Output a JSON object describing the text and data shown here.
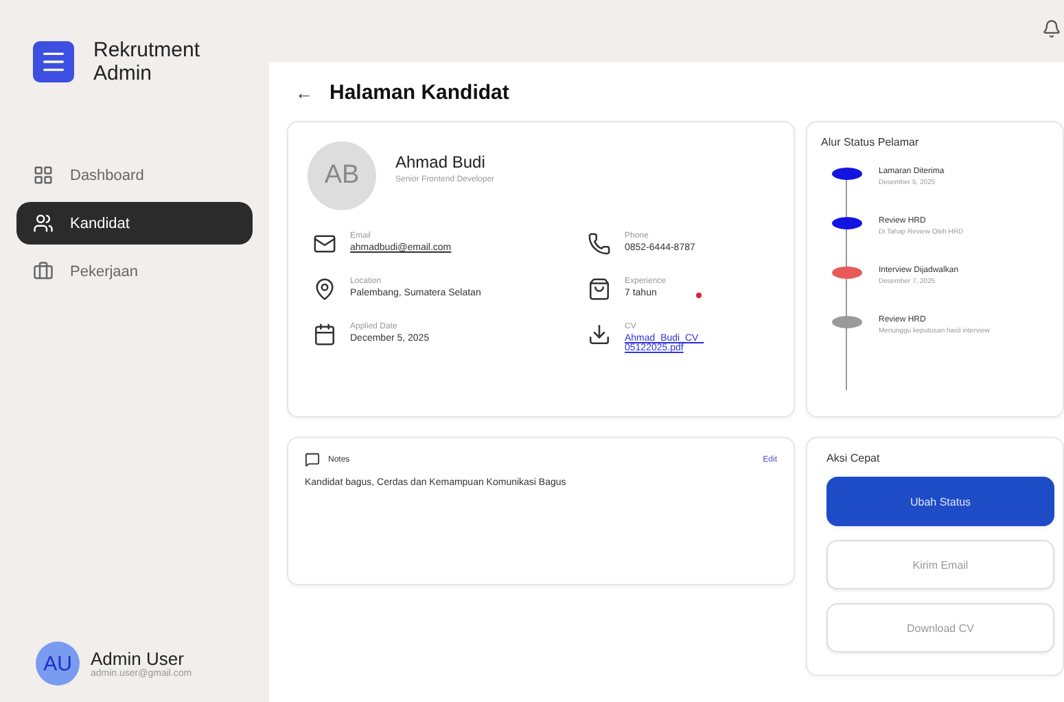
{
  "sidebar": {
    "brand": "Rekrutment Admin",
    "items": [
      {
        "label": "Dashboard",
        "selected": false
      },
      {
        "label": "Kandidat",
        "selected": true
      },
      {
        "label": "Pekerjaan",
        "selected": false
      }
    ],
    "user": {
      "initials": "AU",
      "name": "Admin User",
      "email": "admin.user@gmail.com"
    }
  },
  "page": {
    "back": "←",
    "title": "Halaman Kandidat"
  },
  "profile": {
    "initials": "AB",
    "name": "Ahmad Budi",
    "role": "Senior Frontend Developer",
    "fields": [
      {
        "label": "Email",
        "value": "ahmadbudi@email.com",
        "kind": "link"
      },
      {
        "label": "Phone",
        "value": "0852-6444-8787",
        "kind": "text"
      },
      {
        "label": "Location",
        "value": "Palembang, Sumatera Selatan",
        "kind": "text"
      },
      {
        "label": "Experience",
        "value": "7 tahun",
        "kind": "text",
        "flag": true
      },
      {
        "label": "Applied Date",
        "value": "December 5, 2025",
        "kind": "text"
      },
      {
        "label": "CV",
        "value": "Ahmad_Budi_CV_ 05122025.pdf",
        "kind": "file"
      }
    ]
  },
  "status_flow": {
    "title": "Alur Status Pelamar",
    "steps": [
      {
        "title": "Lamaran Diterima",
        "detail": "Desember 5, 2025",
        "color": "#1414e0"
      },
      {
        "title": "Review HRD",
        "detail": "Di Tahap Review Oleh HRD",
        "color": "#1414e0"
      },
      {
        "title": "Interview Dijadwalkan",
        "detail": "Desember 7, 2025",
        "color": "#e85a5a"
      },
      {
        "title": "Review HRD",
        "detail": "Menunggu keputusan hasil interview",
        "color": "#9a9a9a"
      }
    ]
  },
  "notes": {
    "title": "Notes",
    "action": "Edit",
    "text": "Kandidat bagus, Cerdas dan Kemampuan Komunikasi Bagus"
  },
  "quick_actions": {
    "title": "Aksi Cepat",
    "buttons": [
      {
        "label": "Ubah Status",
        "kind": "primary"
      },
      {
        "label": "Kirim Email",
        "kind": "outline"
      },
      {
        "label": "Download CV",
        "kind": "outline"
      }
    ]
  }
}
